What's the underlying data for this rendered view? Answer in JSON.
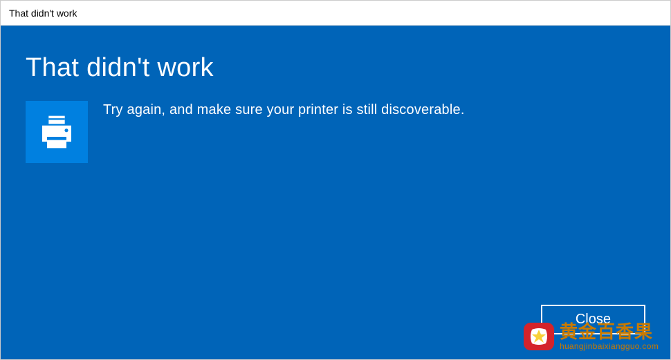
{
  "titlebar": {
    "title": "That didn't work"
  },
  "content": {
    "heading": "That didn't work",
    "message": "Try again, and make sure your printer is still discoverable.",
    "icon_name": "printer-icon"
  },
  "actions": {
    "close_label": "Close"
  },
  "watermark": {
    "chinese": "黄金百香果",
    "pinyin": "huangjinbaixiangguo.com"
  },
  "colors": {
    "primary_bg": "#0064b8",
    "icon_bg": "#0080e0",
    "watermark_text": "#c97a00",
    "watermark_logo_red": "#d4232a",
    "watermark_logo_yellow": "#f8d038"
  }
}
